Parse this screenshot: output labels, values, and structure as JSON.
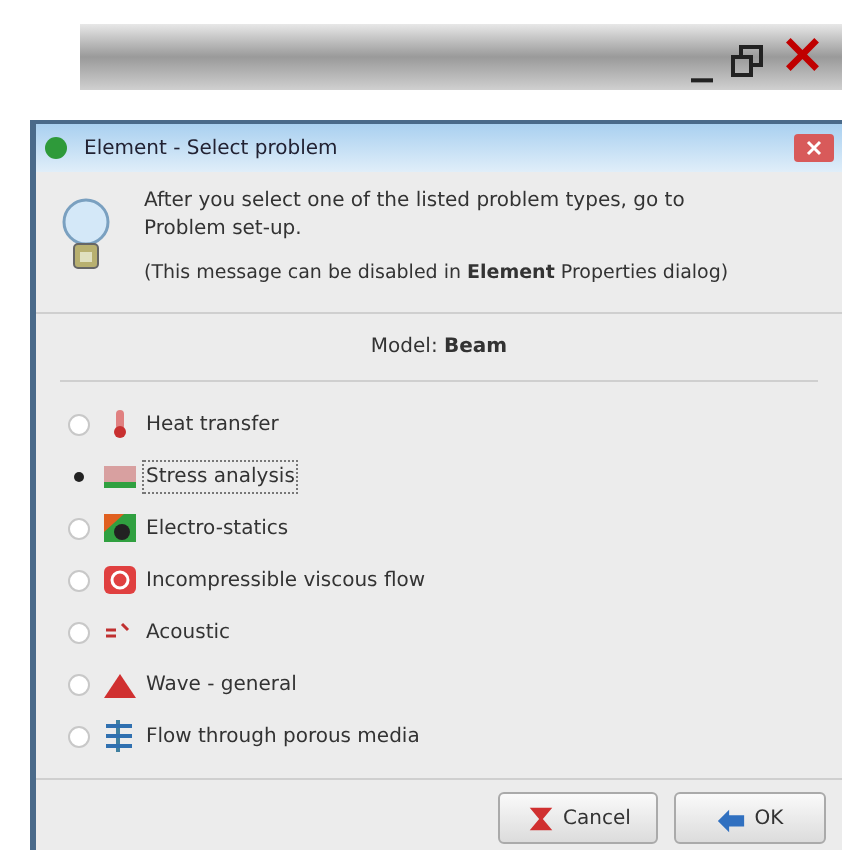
{
  "outer_window": {
    "controls": [
      "_",
      "×"
    ]
  },
  "dialog": {
    "title": "Element - Select problem"
  },
  "message": {
    "text": "After you select one of the listed problem types, go to Problem set-up.",
    "note": "(This message can be disabled in **Element** Properties dialog)"
  },
  "model": "Model: **Beam**",
  "options": [
    {
      "label": "Heat transfer",
      "selected": false
    },
    {
      "label": "Stress analysis",
      "selected": true
    },
    {
      "label": "Electro-statics",
      "selected": false
    },
    {
      "label": "Incompressible viscous flow",
      "selected": false
    },
    {
      "label": "Acoustic",
      "selected": false
    },
    {
      "label": "Wave - general",
      "selected": false
    },
    {
      "label": "Flow through porous media",
      "selected": false
    }
  ],
  "buttons": [
    {
      "label": "Cancel",
      "kind": "cancel"
    },
    {
      "label": "OK",
      "kind": "ok"
    }
  ]
}
